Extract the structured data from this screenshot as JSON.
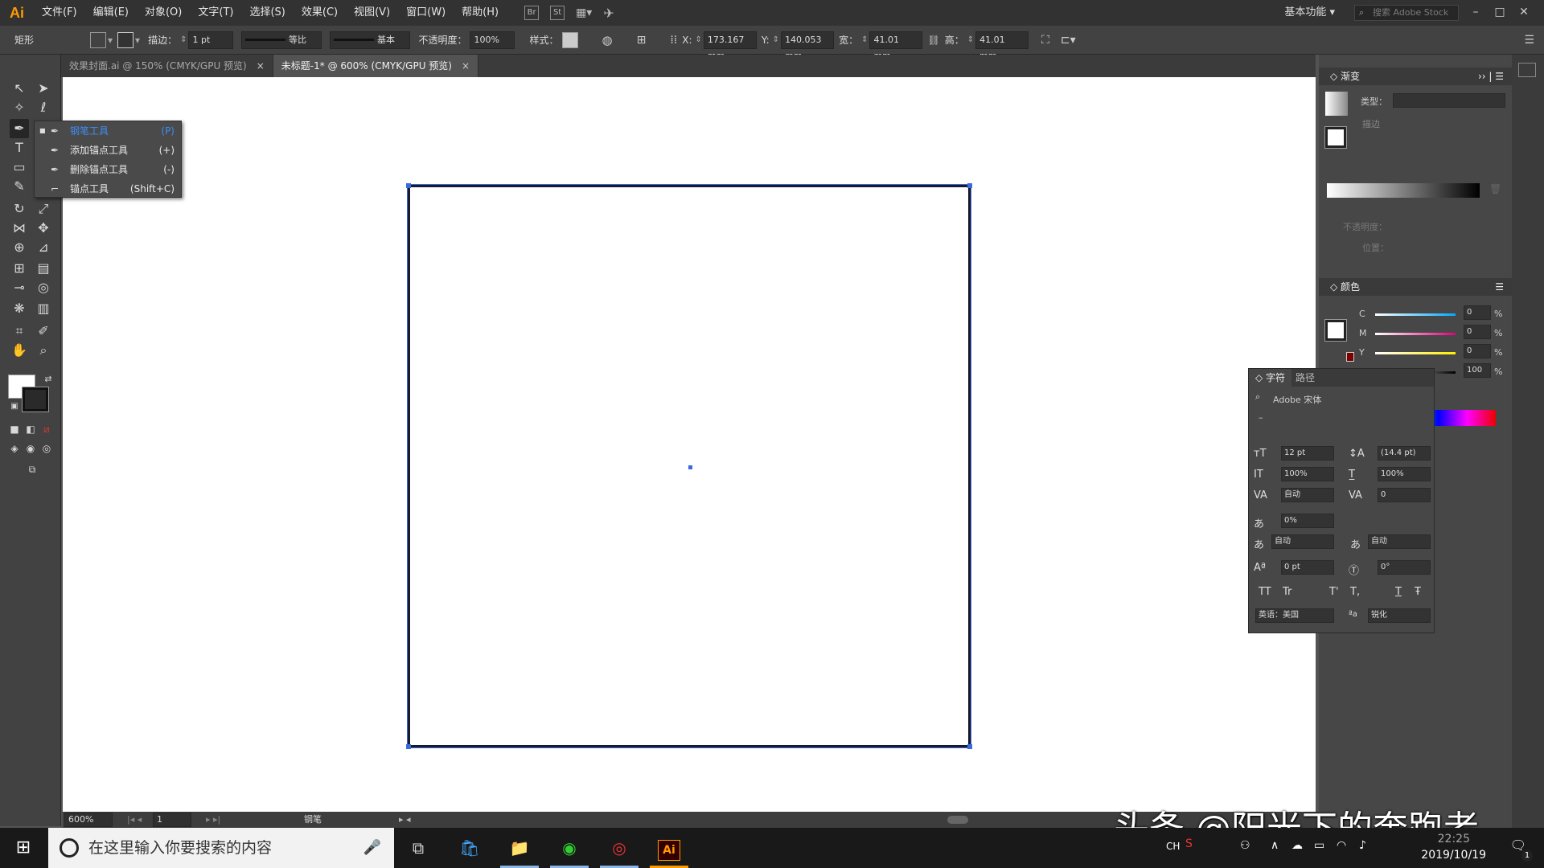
{
  "app": {
    "logo": "Ai"
  },
  "menu": [
    "文件(F)",
    "编辑(E)",
    "对象(O)",
    "文字(T)",
    "选择(S)",
    "效果(C)",
    "视图(V)",
    "窗口(W)",
    "帮助(H)"
  ],
  "menu_icons": [
    "Br",
    "St"
  ],
  "workspace": "基本功能",
  "stock_search_placeholder": "搜索 Adobe Stock",
  "window_controls": [
    "–",
    "□",
    "✕"
  ],
  "controlbar": {
    "object_type": "矩形",
    "stroke_label": "描边：",
    "stroke_value": "1 pt",
    "profile_label": "等比",
    "brush_label": "基本",
    "opacity_label": "不透明度：",
    "opacity_value": "100%",
    "style_label": "样式：",
    "x_label": "X:",
    "x_value": "173.167 mm",
    "y_label": "Y:",
    "y_value": "140.053 mm",
    "w_label": "宽：",
    "w_value": "41.01 mm",
    "h_label": "高：",
    "h_value": "41.01 mm"
  },
  "tabs": [
    {
      "label": "效果封面.ai @ 150% (CMYK/GPU 预览)",
      "active": false
    },
    {
      "label": "未标题-1* @ 600% (CMYK/GPU 预览)",
      "active": true
    }
  ],
  "tab_close": "×",
  "flyout": [
    {
      "icon": "pen-icon",
      "label": "钢笔工具",
      "key": "(P)",
      "active": true
    },
    {
      "icon": "add-anchor-icon",
      "label": "添加锚点工具",
      "key": "(+)",
      "active": false
    },
    {
      "icon": "delete-anchor-icon",
      "label": "删除锚点工具",
      "key": "(-)",
      "active": false
    },
    {
      "icon": "anchor-point-icon",
      "label": "锚点工具",
      "key": "(Shift+C)",
      "active": false
    }
  ],
  "status": {
    "zoom": "600%",
    "page": "1",
    "tool": "钢笔"
  },
  "gradient_panel": {
    "title": "渐变",
    "type_label": "类型：",
    "stroke_label": "描边",
    "opacity_label": "不透明度：",
    "position_label": "位置："
  },
  "color_panel": {
    "title": "颜色",
    "channels": [
      {
        "name": "C",
        "value": "0"
      },
      {
        "name": "M",
        "value": "0"
      },
      {
        "name": "Y",
        "value": "0"
      },
      {
        "name": "K",
        "value": "100"
      }
    ],
    "unit": "%"
  },
  "character_panel": {
    "tabs": [
      "字符",
      "路径"
    ],
    "font": "Adobe 宋体",
    "style": "–",
    "size": "12 pt",
    "leading": "(14.4 pt)",
    "v_scale": "100%",
    "h_scale": "100%",
    "kerning": "自动",
    "tracking": "0",
    "tsume": "0%",
    "aki_left": "自动",
    "aki_right": "自动",
    "baseline": "0 pt",
    "rotation": "0°",
    "language": "英语：美国",
    "antialias": "锐化",
    "style_buttons": [
      "TT",
      "Tr",
      "T'",
      "T,",
      "T",
      "Ŧ"
    ]
  },
  "taskbar": {
    "search_placeholder": "在这里输入你要搜索的内容",
    "lang": "CH",
    "time": "22:25",
    "date": "2019/10/19",
    "notification_count": "1"
  },
  "watermark": "头条 @阳光下的奔跑者",
  "colors": {
    "accent": "#3d8df6",
    "ai_orange": "#ff9a00",
    "ui_dark": "#323232",
    "panel": "#474747"
  }
}
